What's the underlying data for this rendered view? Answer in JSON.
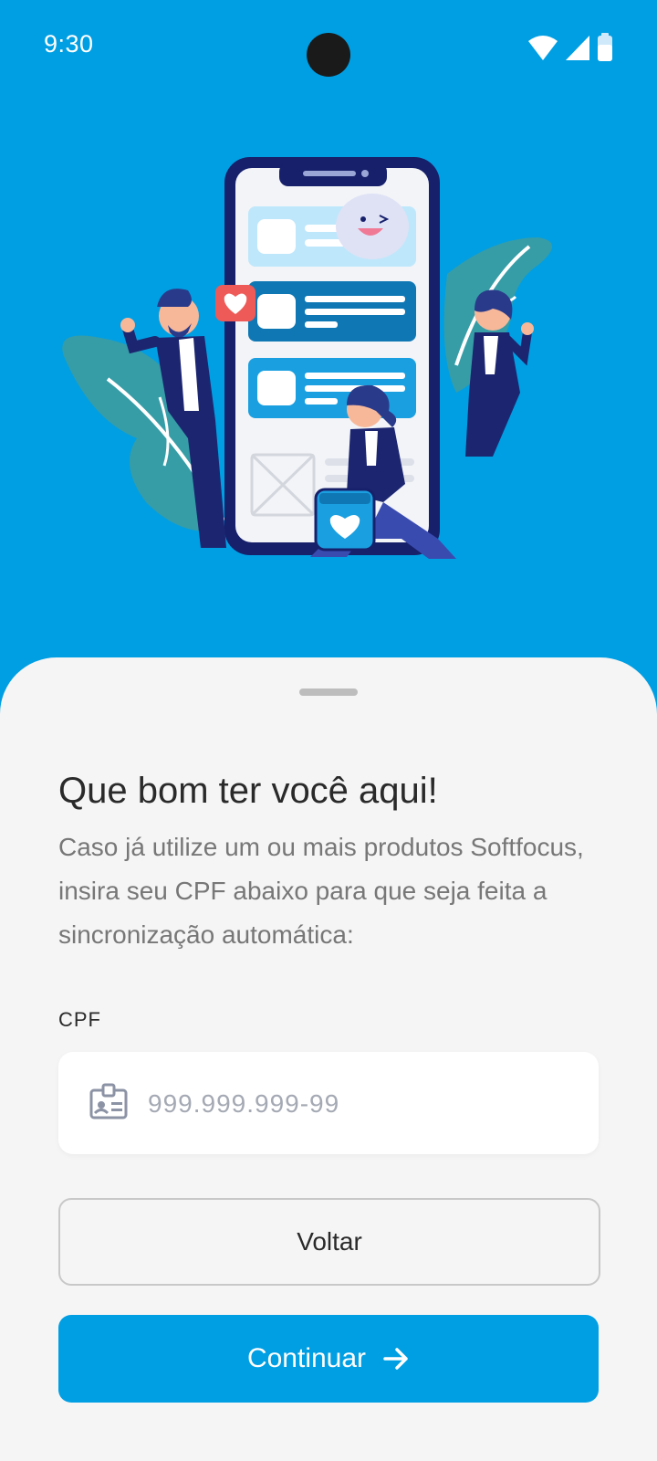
{
  "status_bar": {
    "time": "9:30",
    "icons": [
      "wifi-icon",
      "cellular-signal-icon",
      "battery-icon"
    ]
  },
  "hero": {
    "illustration": "people-with-smartphone-illustration"
  },
  "sheet": {
    "title": "Que bom ter você aqui!",
    "description": "Caso já utilize um ou mais produtos Softfocus, insira seu CPF abaixo para que seja feita a sincronização automática:",
    "cpf": {
      "label": "CPF",
      "placeholder": "999.999.999-99",
      "value": "",
      "icon": "id-card-icon"
    },
    "buttons": {
      "back_label": "Voltar",
      "continue_label": "Continuar",
      "continue_icon": "arrow-right-icon"
    }
  },
  "colors": {
    "brand_blue": "#009fe3",
    "sheet_background": "#f5f5f5",
    "title_text": "#2a2a2a",
    "body_text": "#777777",
    "placeholder_text": "#a4a9b3"
  }
}
